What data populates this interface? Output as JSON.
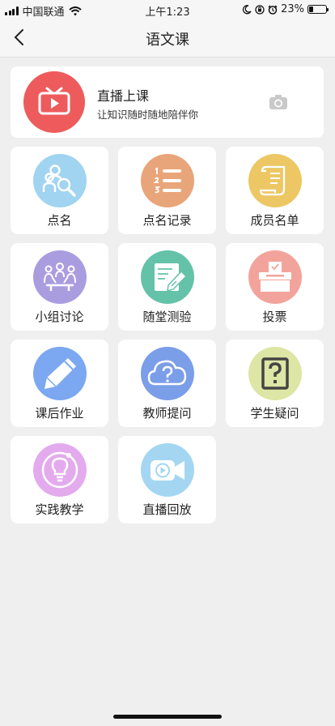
{
  "status": {
    "carrier": "中国联通",
    "time": "上午1:23",
    "battery": "23%",
    "battery_level": 0.23
  },
  "nav": {
    "title": "语文课"
  },
  "live": {
    "title": "直播上课",
    "subtitle": "让知识随时随地陪伴你"
  },
  "tiles": [
    {
      "label": "点名",
      "icon": "roll-call-icon",
      "color": "#a0d4f0"
    },
    {
      "label": "点名记录",
      "icon": "list-record-icon",
      "color": "#e9a57a"
    },
    {
      "label": "成员名单",
      "icon": "scroll-list-icon",
      "color": "#ecc764"
    },
    {
      "label": "小组讨论",
      "icon": "group-discussion-icon",
      "color": "#a99de0"
    },
    {
      "label": "随堂测验",
      "icon": "quiz-pencil-icon",
      "color": "#64c2a8"
    },
    {
      "label": "投票",
      "icon": "ballot-box-icon",
      "color": "#f2a49c"
    },
    {
      "label": "课后作业",
      "icon": "homework-pencil-icon",
      "color": "#7ba8f0"
    },
    {
      "label": "教师提问",
      "icon": "cloud-question-icon",
      "color": "#7b9ee8"
    },
    {
      "label": "学生疑问",
      "icon": "question-box-icon",
      "color": "#dde6a4"
    },
    {
      "label": "实践教学",
      "icon": "lightbulb-icon",
      "color": "#e3abed"
    },
    {
      "label": "直播回放",
      "icon": "video-camera-icon",
      "color": "#a4d6f2"
    }
  ]
}
